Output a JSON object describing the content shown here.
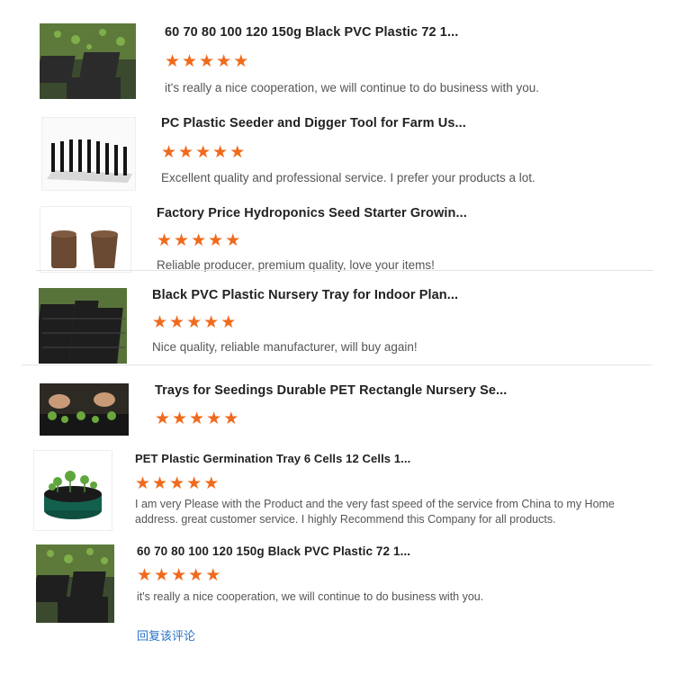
{
  "accent_color": "#f06a1d",
  "link_color": "#2a72c9",
  "reviews": [
    {
      "title": "60 70 80 100 120 150g Black PVC Plastic 72 1...",
      "rating": 5,
      "comment": "it's really a nice cooperation, we will continue to do business with you.",
      "image_icon": "seedling-tray-photo"
    },
    {
      "title": "PC Plastic Seeder and Digger Tool for Farm Us...",
      "rating": 5,
      "comment": "Excellent quality and professional service. I prefer your products a lot.",
      "image_icon": "seeder-tool-photo"
    },
    {
      "title": "Factory Price Hydroponics Seed Starter Growin...",
      "rating": 5,
      "comment": "Reliable producer, premium quality, love your items!",
      "image_icon": "peat-plug-photo"
    },
    {
      "title": "Black PVC Plastic Nursery Tray for Indoor Plan...",
      "rating": 5,
      "comment": "Nice quality, reliable manufacturer, will buy again!",
      "image_icon": "nursery-tray-photo"
    },
    {
      "title": "Trays for Seedings Durable PET Rectangle Nursery Se...",
      "rating": 5,
      "comment": "",
      "image_icon": "seedling-hands-photo"
    },
    {
      "title": "PET Plastic Germination Tray 6 Cells 12 Cells 1...",
      "rating": 5,
      "comment": "I am very Please with the Product and the very fast speed of the service from China to my Home address. great customer service. I highly Recommend this Company for all products.",
      "image_icon": "germination-tray-photo"
    },
    {
      "title": "60 70 80 100 120 150g Black PVC Plastic 72 1...",
      "rating": 5,
      "comment": "it's really a nice cooperation, we will continue to do business with you.",
      "image_icon": "seedling-tray-photo"
    }
  ],
  "reply_link": "回复该评论"
}
